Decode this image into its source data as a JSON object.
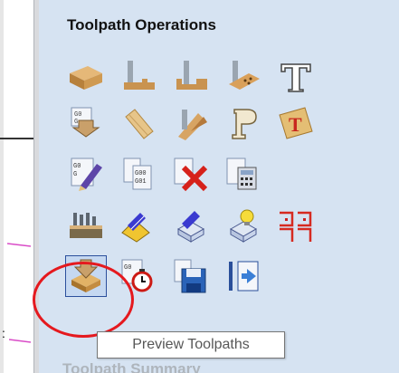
{
  "panel": {
    "title": "Toolpath Operations",
    "next_section_title": "Toolpath Summary"
  },
  "tooltip": {
    "text": "Preview Toolpaths"
  },
  "icons": [
    "material-setup-icon",
    "profile-toolpath-icon",
    "pocket-toolpath-icon",
    "drilling-toolpath-icon",
    "text-engraving-icon",
    "gcode-import-icon",
    "texture-toolpath-icon",
    "prism-carve-icon",
    "fluting-toolpath-icon",
    "vcarve-text-icon",
    "gcode-edit-icon",
    "gcode-compare-icon",
    "delete-toolpath-icon",
    "calculator-icon",
    "tool-database-icon",
    "edit-toolpath-icon",
    "toolpath-template-icon",
    "toolpath-lightbulb-icon",
    "tabs-icon",
    "preview-toolpaths-icon",
    "time-estimate-icon",
    "save-toolpath-icon",
    "toolpath-merge-icon"
  ],
  "colors": {
    "panel_bg": "#d6e3f2",
    "highlight_circle": "#e5191e"
  }
}
